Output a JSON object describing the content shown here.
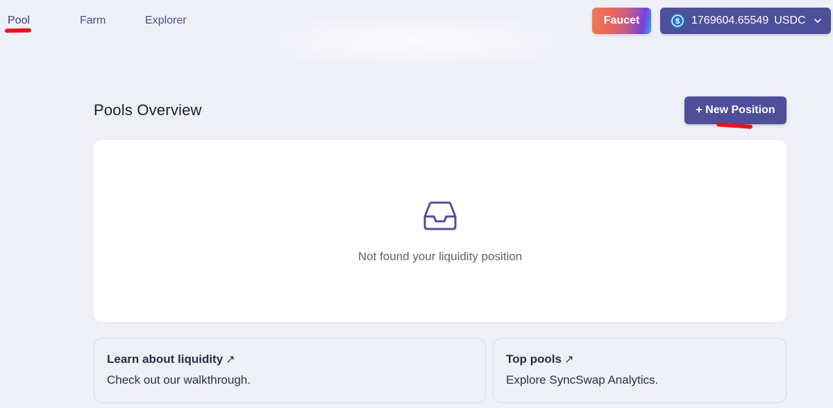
{
  "nav": {
    "pool": "Pool",
    "farm": "Farm",
    "explorer": "Explorer"
  },
  "faucet": {
    "label": "Faucet"
  },
  "wallet": {
    "amount": "1769604.65549",
    "unit": "USDC",
    "icon": "usdc-coin-icon"
  },
  "overview": {
    "title": "Pools Overview",
    "new_position_label": "+ New Position",
    "empty_text": "Not found your liquidity position",
    "empty_icon": "inbox-icon"
  },
  "cards": {
    "learn": {
      "title": "Learn about liquidity",
      "arrow": "↗",
      "desc": "Check out our walkthrough."
    },
    "top": {
      "title": "Top pools",
      "arrow": "↗",
      "desc": "Explore SyncSwap Analytics."
    }
  },
  "colors": {
    "primary": "#4d4f98",
    "annotation": "#e5161b",
    "background": "#efeff8",
    "usdc": "#2775ca"
  }
}
